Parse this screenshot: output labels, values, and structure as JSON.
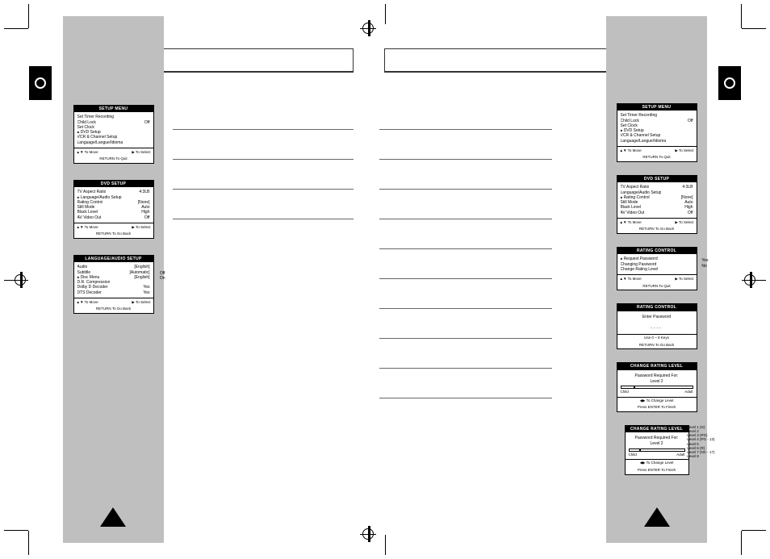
{
  "setup_menu": {
    "title": "SETUP MENU",
    "items": [
      {
        "k": "Set Timer Recording",
        "v": ""
      },
      {
        "k": "Child Lock",
        "v": "Off"
      },
      {
        "k": "Set Clock",
        "v": ""
      },
      {
        "k": "DVD Setup",
        "v": "",
        "sel": true
      },
      {
        "k": "VCR & Channel Setup",
        "v": ""
      },
      {
        "k": "Language/Langue/Idioma",
        "v": ""
      }
    ],
    "footL": "▲▼ To Move",
    "footR": "▶ To Select",
    "foot2": "RETURN To Quit"
  },
  "dvd_setup": {
    "title": "DVD SETUP",
    "items": [
      {
        "k": "TV Aspect Ratio",
        "v": "4:3LB"
      },
      {
        "k": "Language/Audio Setup",
        "v": "",
        "sel": true
      },
      {
        "k": "Rating Control",
        "v": "[None]"
      },
      {
        "k": "Still Mode",
        "v": "Auto"
      },
      {
        "k": "Black Level",
        "v": "High"
      },
      {
        "k": "AV Video Out",
        "v": "Off"
      }
    ],
    "footL": "▲▼ To Move",
    "footR": "▶ To Select",
    "foot2": "RETURN To Go Back"
  },
  "lang_audio": {
    "title": "LANGUAGE/AUDIO SETUP",
    "items": [
      {
        "k": "Audio",
        "v": "[English]"
      },
      {
        "k": "Subtitle",
        "v": "[Automatic]"
      },
      {
        "k": "Disc Menu",
        "v": "[English]",
        "sel": true
      },
      {
        "k": "D.R. Compression",
        "v": ""
      },
      {
        "k": "Dolby D Decoder",
        "v": "Yes"
      },
      {
        "k": "DTS Decoder",
        "v": "Yes"
      }
    ],
    "sideOpts": [
      "Off",
      "On"
    ],
    "footL": "▲▼ To Move",
    "footR": "▶ To Select",
    "foot2": "RETURN To Go Back"
  },
  "dvd_setup_r": {
    "title": "DVD SETUP",
    "items": [
      {
        "k": "TV Aspect Ratio",
        "v": "4:3LB"
      },
      {
        "k": "Language/Audio Setup",
        "v": ""
      },
      {
        "k": "Rating Control",
        "v": "[None]",
        "sel": true
      },
      {
        "k": "Still Mode",
        "v": "Auto"
      },
      {
        "k": "Black Level",
        "v": "High"
      },
      {
        "k": "AV Video Out",
        "v": "Off"
      }
    ],
    "footL": "▲▼ To Move",
    "footR": "▶ To Select",
    "foot2": "RETURN To Go Back"
  },
  "rating_ctrl": {
    "title": "RATING CONTROL",
    "items": [
      {
        "k": "Request Password",
        "v": "",
        "sel": true
      },
      {
        "k": "Changing Password",
        "v": ""
      },
      {
        "k": "Change Rating Level",
        "v": ""
      }
    ],
    "sideOpts": [
      "Yes",
      "No"
    ],
    "footL": "▲▼ To Move",
    "footR": "▶ To Select",
    "foot2": "RETURN To Quit"
  },
  "rating_pw": {
    "title": "RATING CONTROL",
    "prompt": "Enter Password",
    "hint": "Use 0 ~ 9 Keys",
    "foot2": "RETURN To Go Back"
  },
  "change_level": {
    "title": "CHANGE RATING LEVEL",
    "line1": "Password Required For:",
    "line2": "Level 2",
    "childL": "Child",
    "adultL": "Adult",
    "footA": "◀▶ To Change Level",
    "footB": "Press ENTER To Finish"
  },
  "change_level2": {
    "title": "CHANGE RATING LEVEL",
    "line1": "Password Required For:",
    "line2": "Level 2",
    "childL": "Child",
    "adultL": "Adult",
    "footA": "◀▶ To Change Level",
    "footB": "Press ENTER To Finish",
    "levels": [
      "Level 1 (G)",
      "Level 2",
      "Level 3 (PG)",
      "Level 4 (PG - 13)",
      "Level 5",
      "Level 6 (R)",
      "Level 7 (NC - 17)",
      "Level 8"
    ]
  }
}
